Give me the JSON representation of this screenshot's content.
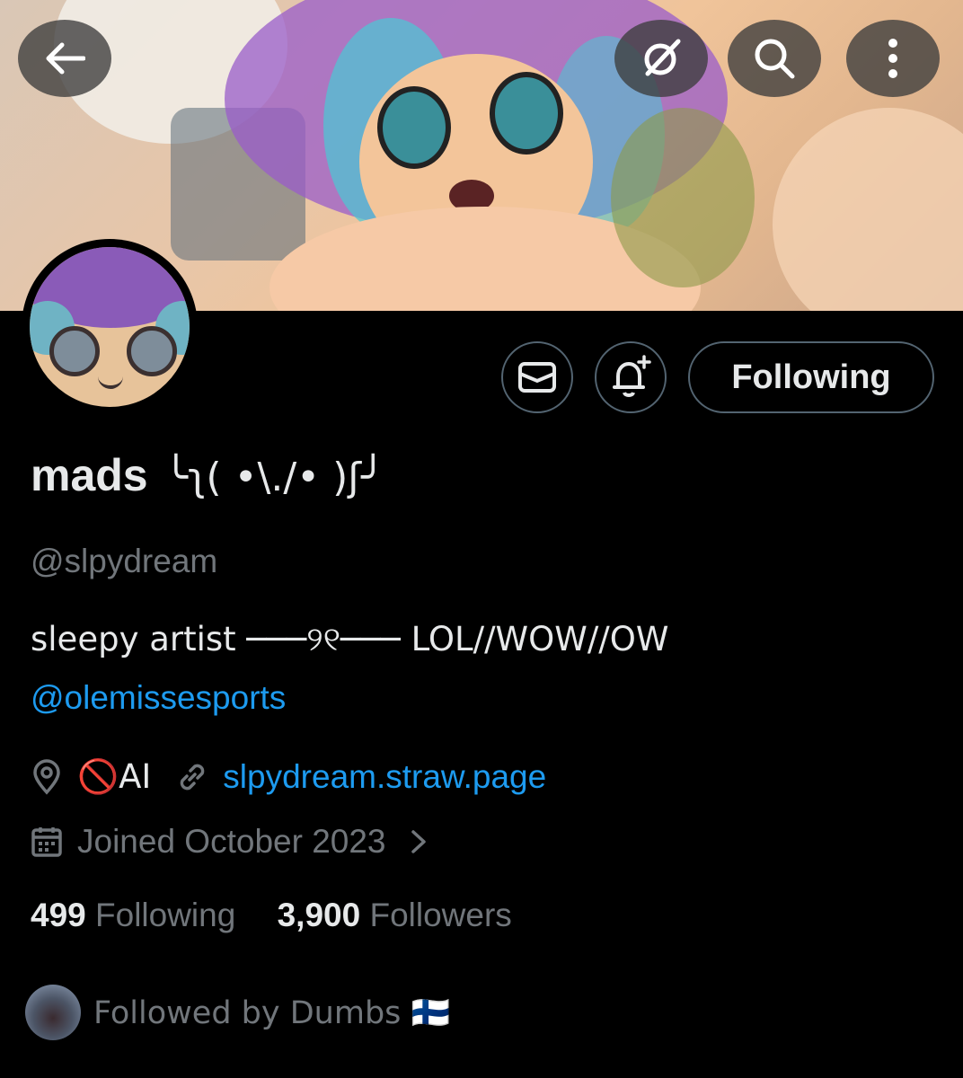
{
  "profile": {
    "name": "mads",
    "name_kaomoji": "╰ʅ( •\\./• )ʃ╯",
    "handle": "@slpydream",
    "bio_text": "sleepy artist ───୨୧─── LOL//WOW//OW",
    "bio_mention": "@olemissesports",
    "location": "🚫AI",
    "website": "slpydream.straw.page",
    "joined": "Joined October 2023",
    "following_count": "499",
    "following_label": "Following",
    "followers_count": "3,900",
    "followers_label": "Followers",
    "followed_by": "Followed by Dumbs 🇫🇮"
  },
  "actions": {
    "follow_state_label": "Following"
  },
  "icons": {
    "back": "back-arrow-icon",
    "grok": "grok-icon",
    "search": "search-icon",
    "more": "more-vertical-icon",
    "message": "envelope-icon",
    "notify": "bell-plus-icon",
    "location": "location-pin-icon",
    "link": "link-icon",
    "calendar": "calendar-icon",
    "chevron": "chevron-right-icon"
  },
  "colors": {
    "accent": "#1d9bf0",
    "muted": "#71767b",
    "text": "#e7e9ea",
    "border": "#536471",
    "background": "#000000"
  }
}
